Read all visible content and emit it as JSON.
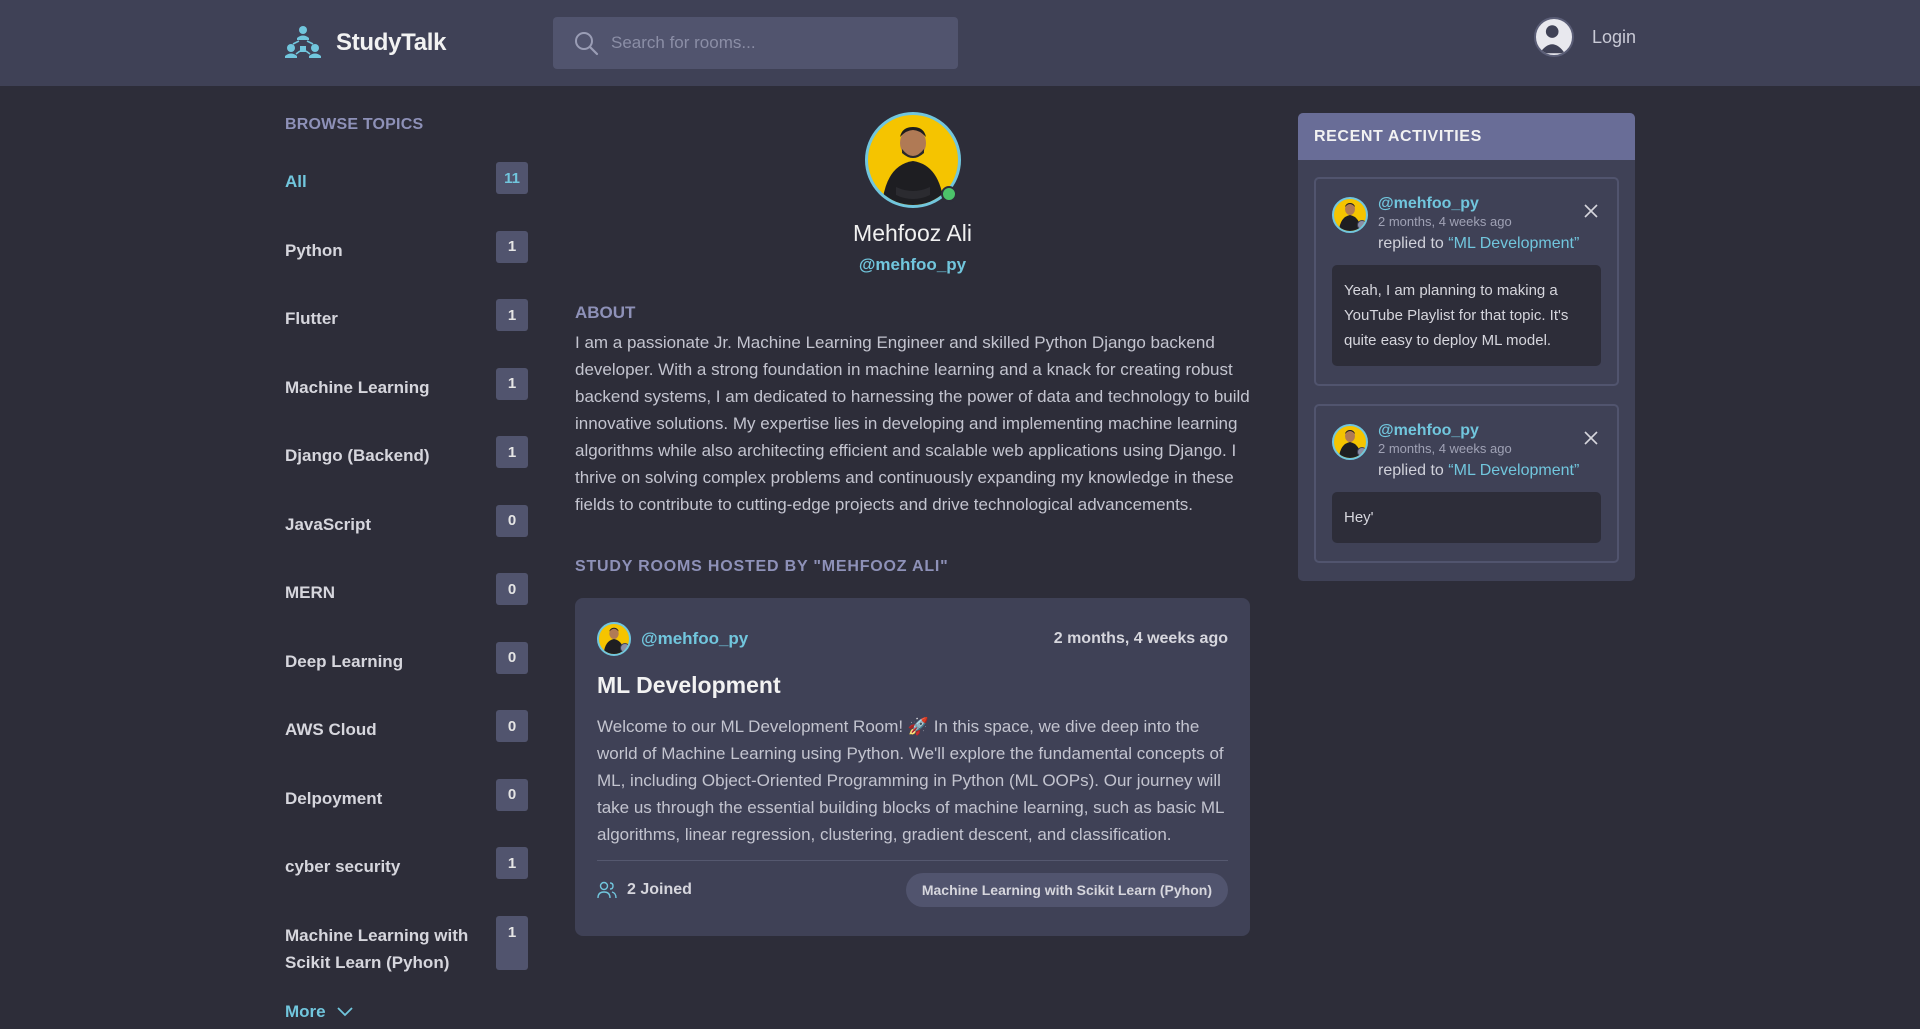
{
  "header": {
    "brand": "StudyTalk",
    "search_placeholder": "Search for rooms...",
    "login_label": "Login",
    "icons": {
      "logo": "network-people-logo",
      "search": "search-icon",
      "login_avatar": "user-avatar-icon"
    }
  },
  "sidebar": {
    "title": "BROWSE TOPICS",
    "topics": [
      {
        "label": "All",
        "count": "11"
      },
      {
        "label": "Python",
        "count": "1"
      },
      {
        "label": "Flutter",
        "count": "1"
      },
      {
        "label": "Machine Learning",
        "count": "1"
      },
      {
        "label": "Django (Backend)",
        "count": "1"
      },
      {
        "label": "JavaScript",
        "count": "0"
      },
      {
        "label": "MERN",
        "count": "0"
      },
      {
        "label": "Deep Learning",
        "count": "0"
      },
      {
        "label": "AWS Cloud",
        "count": "0"
      },
      {
        "label": "Delpoyment",
        "count": "0"
      },
      {
        "label": "cyber security",
        "count": "1"
      },
      {
        "label": "Machine Learning with Scikit Learn (Pyhon)",
        "count": "1"
      }
    ],
    "more_label": "More"
  },
  "profile": {
    "name": "Mehfooz Ali",
    "handle": "@mehfoo_py",
    "about_title": "ABOUT",
    "about_text": "I am a passionate Jr. Machine Learning Engineer and skilled Python Django backend developer. With a strong foundation in machine learning and a knack for creating robust backend systems, I am dedicated to harnessing the power of data and technology to build innovative solutions. My expertise lies in developing and implementing machine learning algorithms while also architecting efficient and scalable web applications using Django. I thrive on solving complex problems and continuously expanding my knowledge in these fields to contribute to cutting-edge projects and drive technological advancements.",
    "rooms_title": "STUDY ROOMS HOSTED BY \"MEHFOOZ ALI\""
  },
  "room": {
    "host": "@mehfoo_py",
    "time": "2 months, 4 weeks ago",
    "title": "ML Development",
    "description": "Welcome to our ML Development Room! 🚀 In this space, we dive deep into the world of Machine Learning using Python. We'll explore the fundamental concepts of ML, including Object-Oriented Programming in Python (ML OOPs). Our journey will take us through the essential building blocks of machine learning, such as basic ML algorithms, linear regression, clustering, gradient descent, and classification.",
    "joined": "2 Joined",
    "topic": "Machine Learning with Scikit Learn (Pyhon)"
  },
  "activities": {
    "title": "RECENT ACTIVITIES",
    "items": [
      {
        "handle": "@mehfoo_py",
        "time": "2 months, 4 weeks ago",
        "action": "replied to",
        "room": "“ML Development”",
        "message": "Yeah, I am planning to making a YouTube Playlist for that topic. It's quite easy to deploy ML model."
      },
      {
        "handle": "@mehfoo_py",
        "time": "2 months, 4 weeks ago",
        "action": "replied to",
        "room": "“ML Development”",
        "message": "Hey'"
      }
    ]
  },
  "colors": {
    "background": "#2d2d39",
    "header": "#3f4156",
    "accent": "#71c6dd",
    "muted_heading": "#8e91b8",
    "activities_header": "#696d97",
    "online": "#4cc36a",
    "avatar_bg": "#f5c400"
  }
}
